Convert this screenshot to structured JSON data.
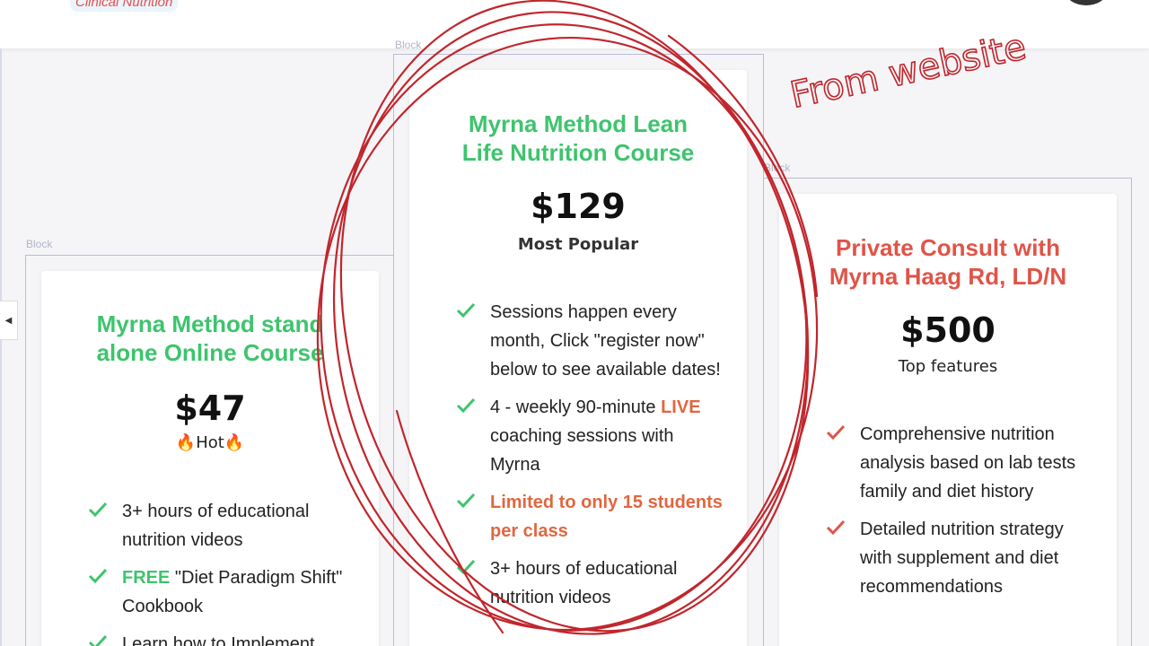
{
  "brand": {
    "logo_text": "Clinical Nutrition"
  },
  "colors": {
    "green": "#3ec46d",
    "red": "#e05448",
    "ink": "#c0262c"
  },
  "nav": {
    "collapse_icon": "chevron-left-icon",
    "collapse_glyph": "◀"
  },
  "block_label": "Block",
  "cards": [
    {
      "title_line1": "Myrna Method stand",
      "title_line2": "alone Online Course",
      "price": "$47",
      "tag": "🔥Hot🔥",
      "features": [
        {
          "text": "3+ hours of educational nutrition videos"
        },
        {
          "highlight": "FREE",
          "text": " \"Diet Paradigm Shift\" Cookbook"
        },
        {
          "text": "Learn how to Implement"
        }
      ]
    },
    {
      "title_line1": "Myrna Method Lean",
      "title_line2": "Life Nutrition Course",
      "price": "$129",
      "tag": "Most Popular",
      "features": [
        {
          "text": "Sessions happen every month, Click \"register now\" below to see available dates!"
        },
        {
          "pre": "4 - weekly 90-minute ",
          "highlight": "LIVE",
          "post": " coaching sessions with Myrna"
        },
        {
          "highlight": "Limited to only 15 students per class"
        },
        {
          "text": "3+ hours of educational nutrition videos"
        }
      ]
    },
    {
      "title_line1": "Private Consult with",
      "title_line2": "Myrna Haag Rd, LD/N",
      "price": "$500",
      "tag": "Top features",
      "features": [
        {
          "text": "Comprehensive nutrition analysis based on lab tests  family and diet history"
        },
        {
          "text": " Detailed nutrition strategy with supplement and diet recommendations"
        }
      ]
    }
  ],
  "annotation": {
    "handwritten_text": "From website"
  }
}
